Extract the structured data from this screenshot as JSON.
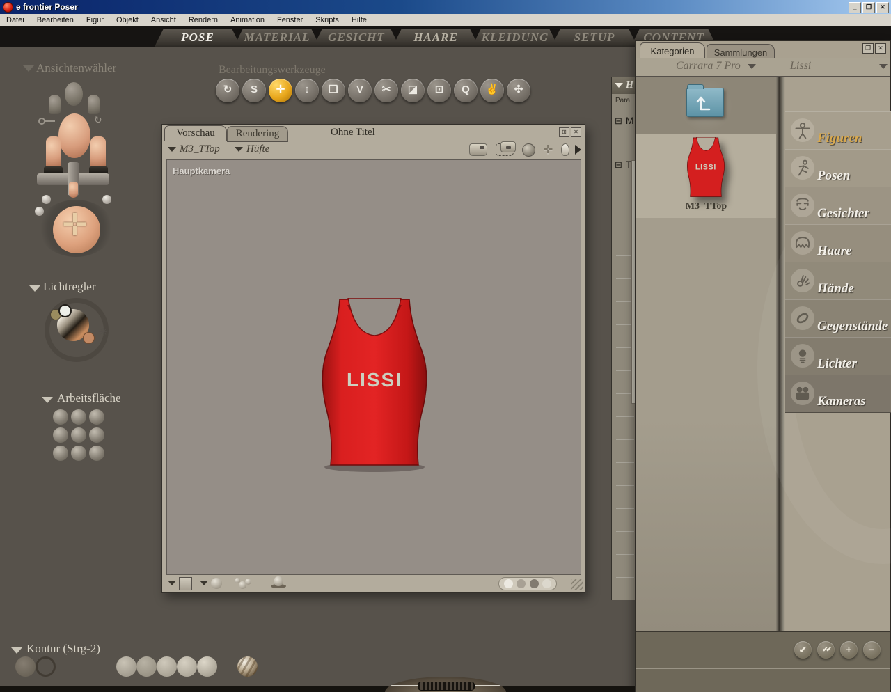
{
  "window": {
    "title": "e frontier Poser",
    "controls": {
      "minimize": "_",
      "restore": "❐",
      "close": "✕"
    }
  },
  "menu": {
    "items": [
      "Datei",
      "Bearbeiten",
      "Figur",
      "Objekt",
      "Ansicht",
      "Rendern",
      "Animation",
      "Fenster",
      "Skripts",
      "Hilfe"
    ]
  },
  "room_tabs": [
    {
      "label": "POSE",
      "active": true
    },
    {
      "label": "MATERIAL",
      "active": false
    },
    {
      "label": "GESICHT",
      "active": false
    },
    {
      "label": "HAARE",
      "active": false
    },
    {
      "label": "KLEIDUNG",
      "active": false
    },
    {
      "label": "SETUP",
      "active": false
    },
    {
      "label": "CONTENT",
      "active": false
    }
  ],
  "sidebar": {
    "view_selector": {
      "label": "Ansichtenwähler"
    },
    "light_controls": {
      "label": "Lichtregler"
    },
    "workspace": {
      "label": "Arbeitsfläche"
    },
    "contour": {
      "label": "Kontur (Strg-2)",
      "selected_style": "outline",
      "styles": [
        "silhouette",
        "outline",
        "wireframe",
        "hidden-line",
        "lit-wireframe",
        "flat-shaded",
        "flat-lined",
        "cartoon",
        "cartoon-lined",
        "smooth-shaded",
        "smooth-lined",
        "texture-shaded"
      ]
    }
  },
  "toolbar": {
    "label": "Bearbeitungswerkzeuge",
    "tools": [
      {
        "name": "rotate",
        "glyph": "↻",
        "selected": false
      },
      {
        "name": "twist",
        "glyph": "S",
        "selected": false
      },
      {
        "name": "translate-pull",
        "glyph": "✛",
        "selected": true
      },
      {
        "name": "translate-in-out",
        "glyph": "↕",
        "selected": false
      },
      {
        "name": "scale",
        "glyph": "❏",
        "selected": false
      },
      {
        "name": "taper",
        "glyph": "V",
        "selected": false
      },
      {
        "name": "chain-break",
        "glyph": "✂",
        "selected": false
      },
      {
        "name": "color",
        "glyph": "◪",
        "selected": false
      },
      {
        "name": "grouping",
        "glyph": "⊡",
        "selected": false
      },
      {
        "name": "view-magnifier",
        "glyph": "Q",
        "selected": false
      },
      {
        "name": "morphing-tool",
        "glyph": "✌",
        "selected": false
      },
      {
        "name": "direct-manipulation",
        "glyph": "✣",
        "selected": false
      }
    ]
  },
  "preview": {
    "tabs": [
      {
        "label": "Vorschau",
        "active": true
      },
      {
        "label": "Rendering",
        "active": false
      }
    ],
    "title": "Ohne Titel",
    "figure_menu": "M3_TTop",
    "actor_menu": "Hüfte",
    "camera_label": "Hauptkamera",
    "garment_logo": "LISSI",
    "header_icons": [
      "camera",
      "camera-dolly",
      "orbit-head",
      "move-cross",
      "light-bulb",
      "expand-arrow"
    ],
    "footer_icons": [
      "background-swatch",
      "display-style",
      "multi-style",
      "shadow-toggle"
    ],
    "tracking_dots": 4,
    "window_icons": {
      "maximize": "⊞",
      "close": "✕"
    }
  },
  "parameters_panel": {
    "header": "H",
    "tab_label": "Para",
    "groups": [
      "M",
      "T"
    ],
    "collapse_glyph": "⊟"
  },
  "library": {
    "tabs": [
      {
        "label": "Kategorien",
        "active": true
      },
      {
        "label": "Sammlungen",
        "active": false
      }
    ],
    "runtime_menu": "Carrara 7 Pro",
    "folder_menu": "Lissi",
    "items": [
      {
        "type": "folder-up",
        "label": ""
      },
      {
        "type": "figure",
        "label": "M3_TTop",
        "selected": true
      }
    ],
    "categories": [
      {
        "label": "Figuren",
        "active": true
      },
      {
        "label": "Posen",
        "active": false
      },
      {
        "label": "Gesichter",
        "active": false
      },
      {
        "label": "Haare",
        "active": false
      },
      {
        "label": "Hände",
        "active": false
      },
      {
        "label": "Gegenstände",
        "active": false
      },
      {
        "label": "Lichter",
        "active": false
      },
      {
        "label": "Kameras",
        "active": false
      }
    ],
    "footer_buttons": [
      {
        "name": "apply-check",
        "glyph": "✔"
      },
      {
        "name": "apply-double-check",
        "glyph": "✔✔"
      },
      {
        "name": "add",
        "glyph": "+"
      },
      {
        "name": "remove",
        "glyph": "−"
      }
    ],
    "window_icons": {
      "panel": "❐",
      "close": "✕"
    }
  },
  "colors": {
    "titlebar_blue": "#0a246a",
    "app_background": "#57524b",
    "accent_gold": "#e8a71c",
    "tank_red": "#d41f1f",
    "panel_taupe": "#a9a190",
    "canvas_gray": "#958e87",
    "active_category_gold": "#d9a94e"
  }
}
